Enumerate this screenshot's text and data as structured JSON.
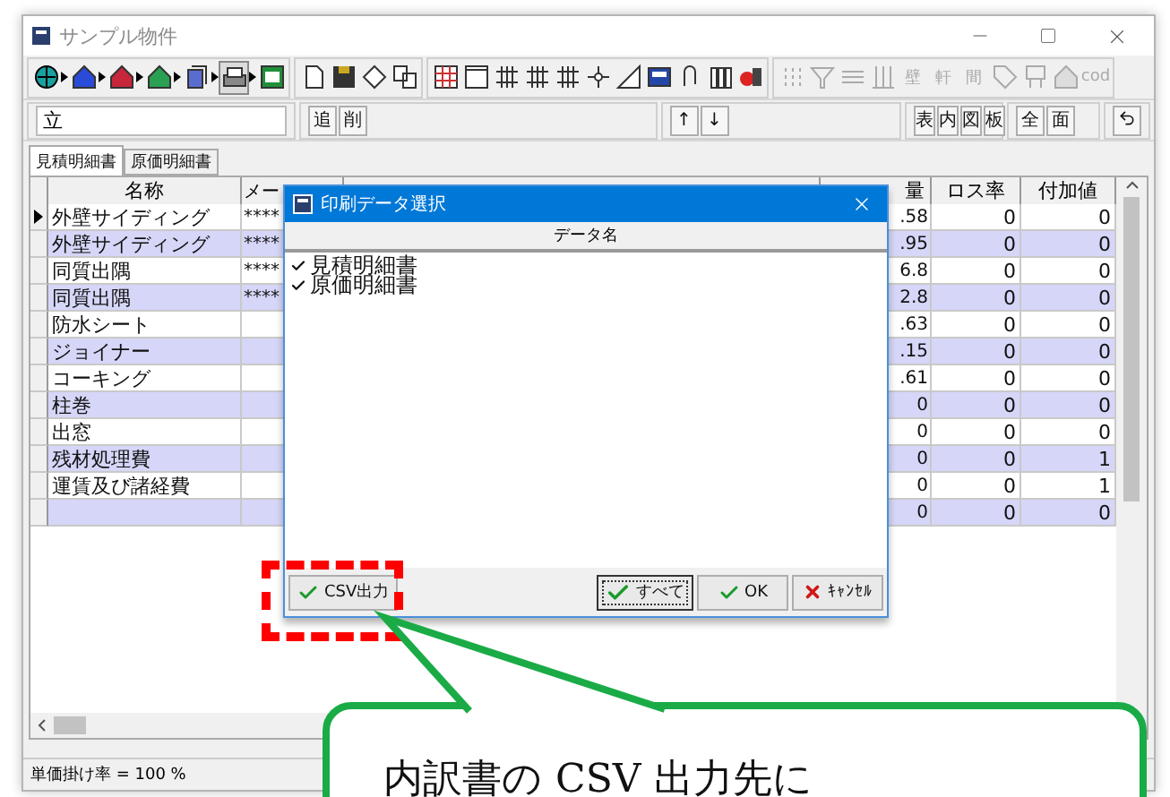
{
  "window": {
    "title": "サンプル物件"
  },
  "toolbar": [
    {
      "kind": "chain",
      "disabled": false,
      "items": [
        {
          "kind": "globe",
          "pressed": false
        },
        {
          "kind": "house",
          "pressed": false
        },
        {
          "kind": "house",
          "pressed": false
        },
        {
          "kind": "house",
          "pressed": false
        },
        {
          "kind": "docs",
          "pressed": false
        },
        {
          "kind": "printer",
          "pressed": true
        },
        {
          "kind": "sheet",
          "pressed": false
        }
      ]
    },
    {
      "kind": "plain",
      "disabled": false,
      "items": [
        {
          "kind": "page"
        },
        {
          "kind": "floppy"
        },
        {
          "kind": "diamond"
        },
        {
          "kind": "copy"
        }
      ]
    },
    {
      "kind": "plain",
      "disabled": false,
      "items": [
        {
          "kind": "table"
        },
        {
          "kind": "window"
        },
        {
          "kind": "grid"
        },
        {
          "kind": "grid"
        },
        {
          "kind": "grid"
        },
        {
          "kind": "cross"
        },
        {
          "kind": "triangle"
        },
        {
          "kind": "calc"
        },
        {
          "kind": "clip"
        },
        {
          "kind": "books"
        },
        {
          "kind": "paint"
        }
      ]
    },
    {
      "kind": "plain",
      "disabled": true,
      "items": [
        {
          "kind": "dots"
        },
        {
          "kind": "funnel"
        },
        {
          "kind": "lines"
        },
        {
          "kind": "columns"
        },
        {
          "kind": "text",
          "label": "壁"
        },
        {
          "kind": "text",
          "label": "軒"
        },
        {
          "kind": "text",
          "label": "間"
        },
        {
          "kind": "tag"
        },
        {
          "kind": "sign"
        },
        {
          "kind": "house"
        },
        {
          "kind": "text",
          "label": "cod"
        }
      ]
    }
  ],
  "edit_bar": {
    "field_value": "立",
    "groups": [
      [
        "追",
        "削"
      ],
      [
        "↑",
        "↓"
      ],
      [
        "表",
        "内",
        "図",
        "板"
      ],
      [
        "全",
        "面"
      ]
    ]
  },
  "tabs": [
    {
      "label": "見積明細書",
      "selected": true
    },
    {
      "label": "原価明細書",
      "selected": false
    }
  ],
  "grid": {
    "columns": {
      "name": "名称",
      "column_2": "メー",
      "column_3": "量",
      "loss_rate": "ロス率",
      "added_value": "付加値"
    },
    "rows": [
      {
        "current": true,
        "name": "外壁サイディング",
        "column_2": "****",
        "column_3": ".58",
        "loss_rate": "0",
        "added_value": "0"
      },
      {
        "current": false,
        "name": "外壁サイディング",
        "column_2": "****",
        "column_3": ".95",
        "loss_rate": "0",
        "added_value": "0"
      },
      {
        "current": false,
        "name": "同質出隅",
        "column_2": "****",
        "column_3": "6.8",
        "loss_rate": "0",
        "added_value": "0"
      },
      {
        "current": false,
        "name": "同質出隅",
        "column_2": "****",
        "column_3": "2.8",
        "loss_rate": "0",
        "added_value": "0"
      },
      {
        "current": false,
        "name": "防水シート",
        "column_3": ".63",
        "loss_rate": "0",
        "added_value": "0"
      },
      {
        "current": false,
        "name": "ジョイナー",
        "column_3": ".15",
        "loss_rate": "0",
        "added_value": "0"
      },
      {
        "current": false,
        "name": "コーキング",
        "column_3": ".61",
        "loss_rate": "0",
        "added_value": "0"
      },
      {
        "current": false,
        "name": "柱巻",
        "column_3": "0",
        "loss_rate": "0",
        "added_value": "0"
      },
      {
        "current": false,
        "name": "出窓",
        "column_3": "0",
        "loss_rate": "0",
        "added_value": "0"
      },
      {
        "current": false,
        "name": "残材処理費",
        "column_3": "0",
        "loss_rate": "0",
        "added_value": "1"
      },
      {
        "current": false,
        "name": "運賃及び諸経費",
        "column_3": "0",
        "loss_rate": "0",
        "added_value": "1"
      },
      {
        "current": false,
        "column_3": "0",
        "loss_rate": "0",
        "added_value": "0"
      }
    ]
  },
  "status_bar": "単価掛け率 = 100 %",
  "dialog": {
    "title": "印刷データ選択",
    "column": "データ名",
    "items": [
      {
        "label": "見積明細書",
        "checked": true
      },
      {
        "label": "原価明細書",
        "checked": true
      }
    ],
    "buttons": [
      {
        "label": "CSV出力",
        "kind": "check",
        "focused": false
      },
      {
        "label": "すべて",
        "kind": "check",
        "focused": true
      },
      {
        "label": "OK",
        "kind": "check",
        "focused": false
      },
      {
        "label": "ｷｬﾝｾﾙ",
        "kind": "cancel",
        "focused": false
      }
    ]
  },
  "annotation": {
    "text": "内訳書の CSV 出力先に"
  }
}
